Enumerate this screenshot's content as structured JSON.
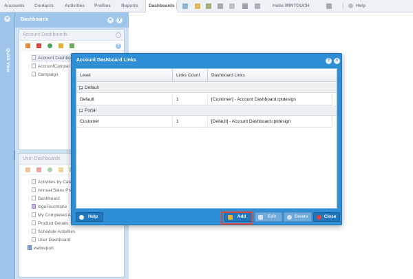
{
  "topnav": {
    "items": [
      "Accounts",
      "Contacts",
      "Activities",
      "Profiles",
      "Reports",
      "Dashboards"
    ],
    "active": "Dashboards",
    "user": "Hello WINTOUCH",
    "help": "Help"
  },
  "quick_view": {
    "label": "Quick View"
  },
  "dashboards_panel": {
    "title": "Dashboards",
    "account_section": {
      "title": "Account Dashboards",
      "items": [
        "Account Dashbo",
        "AccountCampai",
        "Campaign"
      ]
    },
    "user_section": {
      "title": "User Dashboards",
      "items": [
        "Activities by Cate",
        "Annual Sales Pro",
        "Dashboard",
        "logoTouchtone",
        "My Completed A",
        "Product Details",
        "Schedule Activities",
        "User Dashboard",
        "webreport"
      ]
    }
  },
  "modal": {
    "title": "Account Dashboard Links",
    "columns": [
      "Level",
      "Links Count",
      "Dashboard Links"
    ],
    "groups": [
      {
        "name": "Default",
        "rows": [
          {
            "level": "Default",
            "count": "1",
            "links": "[Customer] - Account Dashboard.rptdesign"
          }
        ]
      },
      {
        "name": "Portal",
        "rows": [
          {
            "level": "Customer",
            "count": "1",
            "links": "[Default] - Account Dashboard.rptdesign"
          }
        ]
      }
    ],
    "buttons": {
      "help": "Help",
      "add": "Add",
      "edit": "Edit",
      "delete": "Delete",
      "close": "Close"
    }
  },
  "colors": {
    "accent": "#2f8fd6",
    "panel": "#9fc6ea",
    "highlight": "#e0463a"
  }
}
